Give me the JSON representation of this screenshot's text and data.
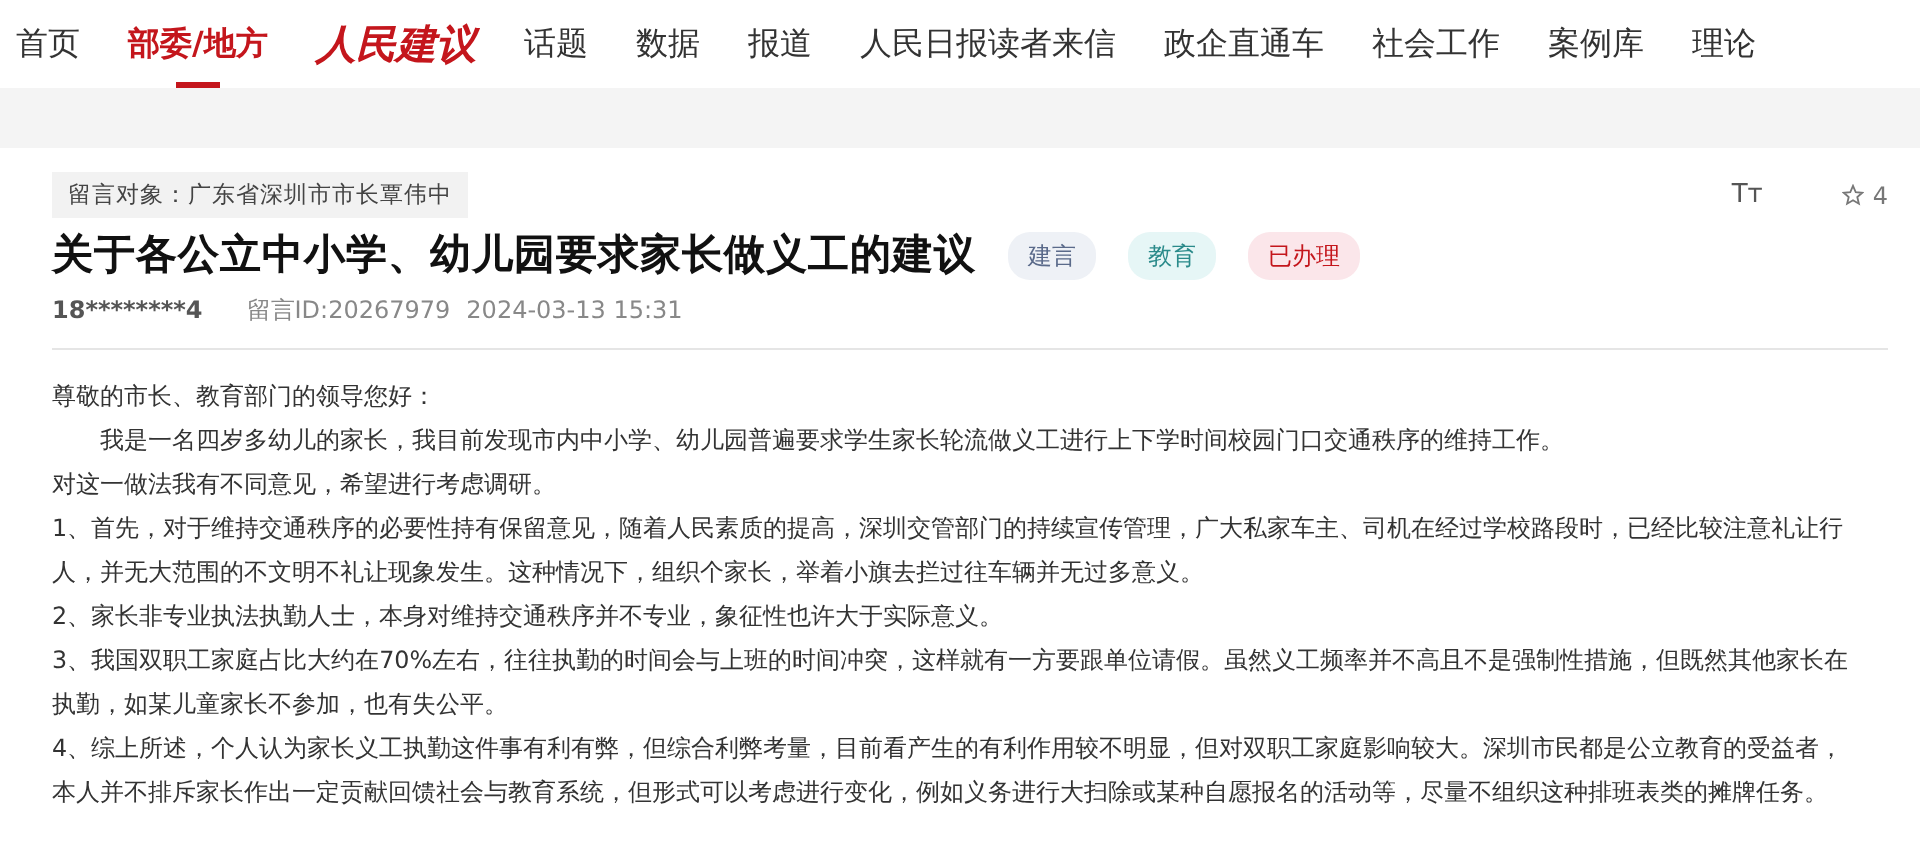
{
  "nav": [
    {
      "label": "首页",
      "kind": "link",
      "selected": false
    },
    {
      "label": "部委/地方",
      "kind": "link",
      "selected": true
    },
    {
      "label": "人民建议",
      "kind": "logo",
      "selected": false
    },
    {
      "label": "话题",
      "kind": "link",
      "selected": false
    },
    {
      "label": "数据",
      "kind": "link",
      "selected": false
    },
    {
      "label": "报道",
      "kind": "link",
      "selected": false
    },
    {
      "label": "人民日报读者来信",
      "kind": "link",
      "selected": false
    },
    {
      "label": "政企直通车",
      "kind": "link",
      "selected": false
    },
    {
      "label": "社会工作",
      "kind": "link",
      "selected": false
    },
    {
      "label": "案例库",
      "kind": "link",
      "selected": false
    },
    {
      "label": "理论",
      "kind": "link",
      "selected": false
    }
  ],
  "message": {
    "recipient": "留言对象：广东省深圳市市长覃伟中",
    "font_size_icon": "Tт",
    "star_count": "4",
    "title": "关于各公立中小学、幼儿园要求家长做义工的建议",
    "tags": [
      {
        "label": "建言",
        "color": "#eef1f6"
      },
      {
        "label": "教育",
        "color": "#e6f6f6"
      },
      {
        "label": "已办理",
        "color": "#fbe6ea"
      }
    ],
    "author": "18********4",
    "message_id": "留言ID:20267979",
    "datetime": "2024-03-13 15:31",
    "paragraphs": [
      "尊敬的市长、教育部门的领导您好：",
      "　　我是一名四岁多幼儿的家长，我目前发现市内中小学、幼儿园普遍要求学生家长轮流做义工进行上下学时间校园门口交通秩序的维持工作。",
      "对这一做法我有不同意见，希望进行考虑调研。",
      "1、首先，对于维持交通秩序的必要性持有保留意见，随着人民素质的提高，深圳交管部门的持续宣传管理，广大私家车主、司机在经过学校路段时，已经比较注意礼让行人，并无大范围的不文明不礼让现象发生。这种情况下，组织个家长，举着小旗去拦过往车辆并无过多意义。",
      "2、家长非专业执法执勤人士，本身对维持交通秩序并不专业，象征性也许大于实际意义。",
      "3、我国双职工家庭占比大约在70%左右，往往执勤的时间会与上班的时间冲突，这样就有一方要跟单位请假。虽然义工频率并不高且不是强制性措施，但既然其他家长在执勤，如某儿童家长不参加，也有失公平。",
      "4、综上所述，个人认为家长义工执勤这件事有利有弊，但综合利弊考量，目前看产生的有利作用较不明显，但对双职工家庭影响较大。深圳市民都是公立教育的受益者，本人并不排斥家长作出一定贡献回馈社会与教育系统，但形式可以考虑进行变化，例如义务进行大扫除或某种自愿报名的活动等，尽量不组织这种排班表类的摊牌任务。"
    ]
  }
}
